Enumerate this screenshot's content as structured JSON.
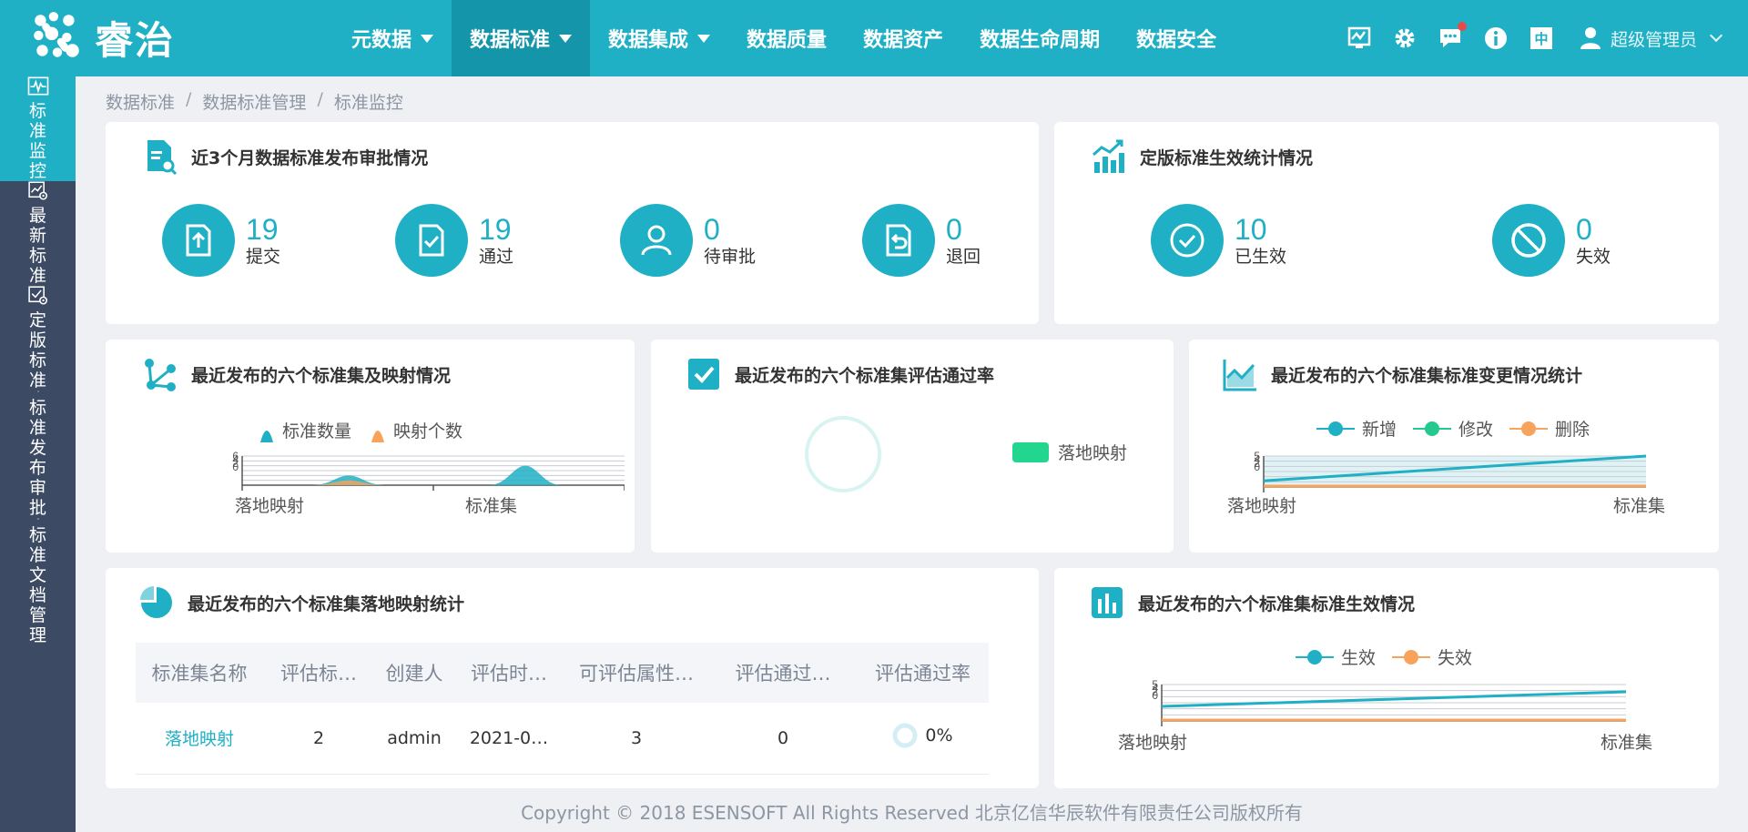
{
  "app": {
    "brand": "睿治",
    "accent": "#1fb0c5",
    "sidebar_bg": "#3c4a63"
  },
  "nav": {
    "items": [
      {
        "label": "元数据",
        "has_menu": true
      },
      {
        "label": "数据标准",
        "has_menu": true,
        "active": true
      },
      {
        "label": "数据集成",
        "has_menu": true
      },
      {
        "label": "数据质量"
      },
      {
        "label": "数据资产"
      },
      {
        "label": "数据生命周期"
      },
      {
        "label": "数据安全"
      }
    ],
    "lang_label": "中",
    "user_name": "超级管理员"
  },
  "sidebar": {
    "items": [
      {
        "label": "标准监控",
        "icon": "monitor-icon",
        "active": true
      },
      {
        "label": "最新标准",
        "icon": "chart-gear-icon"
      },
      {
        "label": "定版标准",
        "icon": "check-gear-icon"
      },
      {
        "label": "标准发布审批",
        "icon": "edit-doc-icon"
      },
      {
        "label": "标准文档管理",
        "icon": "folder-gear-icon"
      }
    ]
  },
  "breadcrumb": [
    "数据标准",
    "数据标准管理",
    "标准监控"
  ],
  "approval": {
    "title": "近3个月数据标准发布审批情况",
    "stats": [
      {
        "value": "19",
        "label": "提交",
        "icon": "upload-file-icon"
      },
      {
        "value": "19",
        "label": "通过",
        "icon": "check-file-icon"
      },
      {
        "value": "0",
        "label": "待审批",
        "icon": "person-icon"
      },
      {
        "value": "0",
        "label": "退回",
        "icon": "return-file-icon"
      }
    ]
  },
  "effective": {
    "title": "定版标准生效统计情况",
    "stats": [
      {
        "value": "10",
        "label": "已生效",
        "icon": "check-circle-icon"
      },
      {
        "value": "0",
        "label": "失效",
        "icon": "ban-icon"
      }
    ]
  },
  "mapping_chart": {
    "title": "最近发布的六个标准集及映射情况",
    "legend": [
      "标准数量",
      "映射个数"
    ],
    "y_ticks": [
      "6",
      "4",
      "2",
      "0"
    ],
    "categories": [
      "落地映射",
      "标准集"
    ]
  },
  "pass_rate": {
    "title": "最近发布的六个标准集评估通过率",
    "legend": [
      "落地映射"
    ]
  },
  "change_chart": {
    "title": "最近发布的六个标准集标准变更情况统计",
    "legend": [
      "新增",
      "修改",
      "删除"
    ],
    "y_ticks": [
      "5",
      "4",
      "2",
      "0"
    ],
    "categories": [
      "落地映射",
      "标准集"
    ]
  },
  "landing_table": {
    "title": "最近发布的六个标准集落地映射统计",
    "columns": [
      "标准集名称",
      "评估标…",
      "创建人",
      "评估时…",
      "可评估属性…",
      "评估通过…",
      "评估通过率"
    ],
    "rows": [
      {
        "name": "落地映射",
        "std": "2",
        "creator": "admin",
        "time": "2021-0…",
        "attrs": "3",
        "passed": "0",
        "rate": "0%"
      }
    ]
  },
  "effect_chart": {
    "title": "最近发布的六个标准集标准生效情况",
    "legend": [
      "生效",
      "失效"
    ],
    "y_ticks": [
      "5",
      "4",
      "2",
      "0"
    ],
    "categories": [
      "落地映射",
      "标准集"
    ]
  },
  "chart_data": [
    {
      "type": "area",
      "categories": [
        "落地映射",
        "标准集"
      ],
      "series": [
        {
          "name": "标准数量",
          "values": [
            2,
            4
          ]
        },
        {
          "name": "映射个数",
          "values": [
            1,
            0
          ]
        }
      ]
    },
    {
      "type": "pie",
      "series": [
        {
          "name": "落地映射",
          "values": [
            0
          ]
        }
      ]
    },
    {
      "type": "line",
      "categories": [
        "落地映射",
        "标准集"
      ],
      "series": [
        {
          "name": "新增",
          "values": [
            1,
            5
          ]
        },
        {
          "name": "修改",
          "values": [
            0,
            0
          ]
        },
        {
          "name": "删除",
          "values": [
            0,
            0
          ]
        }
      ]
    },
    {
      "type": "line",
      "categories": [
        "落地映射",
        "标准集"
      ],
      "series": [
        {
          "name": "生效",
          "values": [
            2,
            4
          ]
        },
        {
          "name": "失效",
          "values": [
            0,
            0
          ]
        }
      ]
    }
  ],
  "footer": "Copyright © 2018 ESENSOFT All Rights Reserved 北京亿信华辰软件有限责任公司版权所有"
}
